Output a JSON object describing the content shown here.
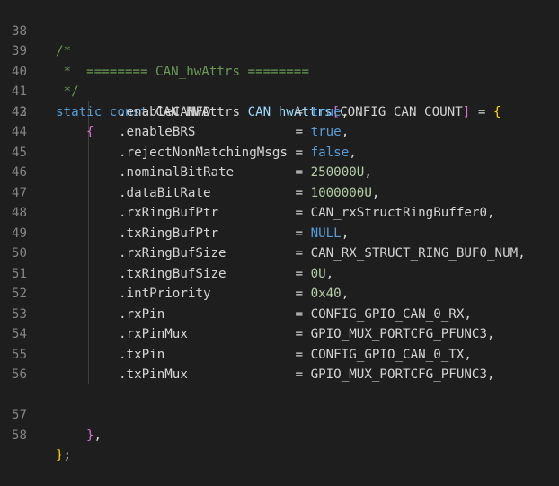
{
  "editor": {
    "line_numbers": [
      "38",
      "39",
      "40",
      "41",
      "42",
      "43",
      "44",
      "45",
      "46",
      "47",
      "48",
      "49",
      "50",
      "51",
      "52",
      "53",
      "54",
      "55",
      "56",
      "57",
      "58"
    ],
    "comment_open": "/*",
    "comment_star": " *",
    "comment_title": "  ======== CAN_hwAttrs ========",
    "comment_close": " */",
    "decl": {
      "kw_static": "static",
      "kw_const": "const",
      "type": "CAN_HWAttrs",
      "var": "CAN_hwAttrs",
      "bracket_open": "[",
      "size_macro": "CONFIG_CAN_COUNT",
      "bracket_close": "]",
      "assign": " = ",
      "brace_open": "{"
    },
    "inner_brace_open": "{",
    "fields": [
      {
        "name": ".enableCANFD",
        "pad": "           ",
        "eq": "= ",
        "value": "true",
        "kind": "kw",
        "comma": ","
      },
      {
        "name": ".enableBRS",
        "pad": "             ",
        "eq": "= ",
        "value": "true",
        "kind": "kw",
        "comma": ","
      },
      {
        "name": ".rejectNonMatchingMsgs",
        "pad": " ",
        "eq": "= ",
        "value": "false",
        "kind": "kw",
        "comma": ","
      },
      {
        "name": ".nominalBitRate",
        "pad": "        ",
        "eq": "= ",
        "value": "250000U",
        "kind": "num",
        "comma": ","
      },
      {
        "name": ".dataBitRate",
        "pad": "           ",
        "eq": "= ",
        "value": "1000000U",
        "kind": "num",
        "comma": ","
      },
      {
        "name": ".rxRingBufPtr",
        "pad": "          ",
        "eq": "= ",
        "value": "CAN_rxStructRingBuffer0",
        "kind": "plain",
        "comma": ","
      },
      {
        "name": ".txRingBufPtr",
        "pad": "          ",
        "eq": "= ",
        "value": "NULL",
        "kind": "kw",
        "comma": ","
      },
      {
        "name": ".rxRingBufSize",
        "pad": "         ",
        "eq": "= ",
        "value": "CAN_RX_STRUCT_RING_BUF0_NUM",
        "kind": "plain",
        "comma": ","
      },
      {
        "name": ".txRingBufSize",
        "pad": "         ",
        "eq": "= ",
        "value": "0U",
        "kind": "num",
        "comma": ","
      },
      {
        "name": ".intPriority",
        "pad": "           ",
        "eq": "= ",
        "value": "0x40",
        "kind": "num",
        "comma": ","
      },
      {
        "name": ".rxPin",
        "pad": "                 ",
        "eq": "= ",
        "value": "CONFIG_GPIO_CAN_0_RX",
        "kind": "plain",
        "comma": ","
      },
      {
        "name": ".rxPinMux",
        "pad": "              ",
        "eq": "= ",
        "value": "GPIO_MUX_PORTCFG_PFUNC3",
        "kind": "plain",
        "comma": ","
      },
      {
        "name": ".txPin",
        "pad": "                 ",
        "eq": "= ",
        "value": "CONFIG_GPIO_CAN_0_TX",
        "kind": "plain",
        "comma": ","
      },
      {
        "name": ".txPinMux",
        "pad": "              ",
        "eq": "= ",
        "value": "GPIO_MUX_PORTCFG_PFUNC3",
        "kind": "plain",
        "comma": ","
      }
    ],
    "inner_brace_close": "}",
    "inner_close_comma": ",",
    "outer_close": "}",
    "semicolon": ";"
  },
  "colors": {
    "background": "#1e1e1e",
    "line_number": "#858585",
    "comment": "#6a9955",
    "keyword": "#569cd6",
    "type": "#4ec9b0",
    "variable": "#9cdcfe",
    "number": "#b5cea8",
    "bracket_level1": "#ffd700",
    "bracket_level2": "#da70d6",
    "bracket_level3": "#179fff"
  }
}
